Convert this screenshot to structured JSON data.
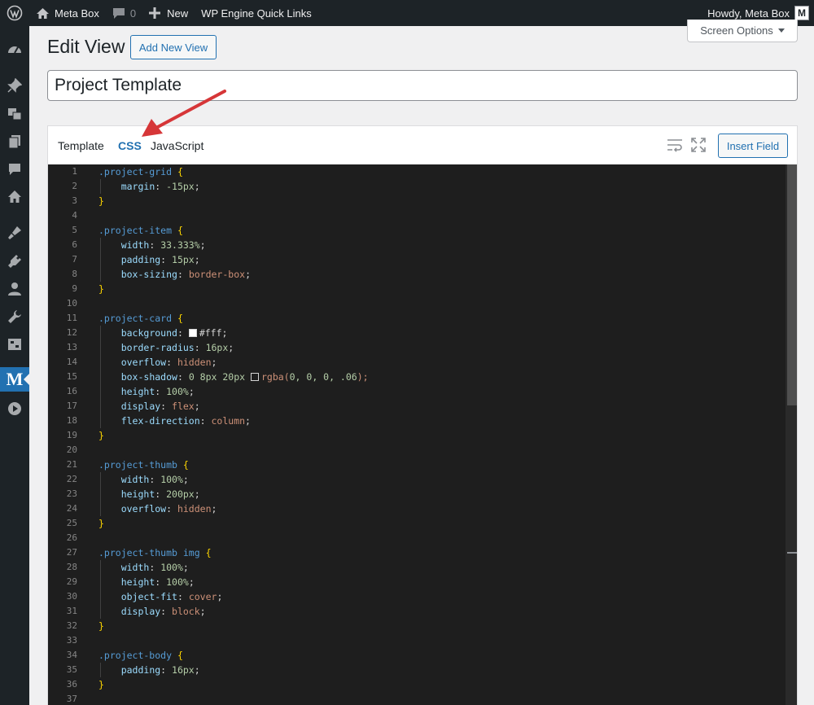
{
  "admin_bar": {
    "site_name": "Meta Box",
    "comments_count": "0",
    "new_label": "New",
    "quick_links": "WP Engine Quick Links",
    "howdy": "Howdy, Meta Box",
    "avatar_letter": "M"
  },
  "sidebar": {
    "items": [
      "dashboard-icon",
      "pin-icon",
      "media-icon",
      "pages-icon",
      "comments-icon",
      "home-icon",
      "appearance-icon",
      "plugins-icon",
      "users-icon",
      "tools-icon",
      "settings-icon",
      "meta-box-icon",
      "play-icon"
    ],
    "current_label": "M"
  },
  "screen_options": "Screen Options",
  "page": {
    "title": "Edit View",
    "add_new": "Add New View",
    "view_title": "Project Template"
  },
  "editor": {
    "tabs": [
      "Template",
      "CSS",
      "JavaScript"
    ],
    "active_tab": "CSS",
    "insert_field": "Insert Field",
    "line_numbers": [
      "1",
      "2",
      "3",
      "4",
      "5",
      "6",
      "7",
      "8",
      "9",
      "10",
      "11",
      "12",
      "13",
      "14",
      "15",
      "16",
      "17",
      "18",
      "19",
      "20",
      "21",
      "22",
      "23",
      "24",
      "25",
      "26",
      "27",
      "28",
      "29",
      "30",
      "31",
      "32",
      "33",
      "34",
      "35",
      "36",
      "37"
    ],
    "code": {
      "l1_sel": ".project-grid",
      "l2_prop": "margin",
      "l2_val": "-15px",
      "l5_sel": ".project-item",
      "l6_prop": "width",
      "l6_val": "33.333%",
      "l7_prop": "padding",
      "l7_val": "15px",
      "l8_prop": "box-sizing",
      "l8_val": "border-box",
      "l11_sel": ".project-card",
      "l12_prop": "background",
      "l12_val": "#fff",
      "l13_prop": "border-radius",
      "l13_val": "16px",
      "l14_prop": "overflow",
      "l14_val": "hidden",
      "l15_prop": "box-shadow",
      "l15_num": "0 8px 20px",
      "l15_fn": "rgba(",
      "l15_args": "0, 0, 0, .06",
      "l15_close": ");",
      "l16_prop": "height",
      "l16_val": "100%",
      "l17_prop": "display",
      "l17_val": "flex",
      "l18_prop": "flex-direction",
      "l18_val": "column",
      "l21_sel": ".project-thumb",
      "l22_prop": "width",
      "l22_val": "100%",
      "l23_prop": "height",
      "l23_val": "200px",
      "l24_prop": "overflow",
      "l24_val": "hidden",
      "l27_sel": ".project-thumb img",
      "l28_prop": "width",
      "l28_val": "100%",
      "l29_prop": "height",
      "l29_val": "100%",
      "l30_prop": "object-fit",
      "l30_val": "cover",
      "l31_prop": "display",
      "l31_val": "block",
      "l34_sel": ".project-body",
      "l35_prop": "padding",
      "l35_val": "16px"
    }
  },
  "colors": {
    "accent": "#2271b1",
    "admin_bar": "#1d2327",
    "code_bg": "#1e1e1e",
    "arrow": "#d63638"
  }
}
